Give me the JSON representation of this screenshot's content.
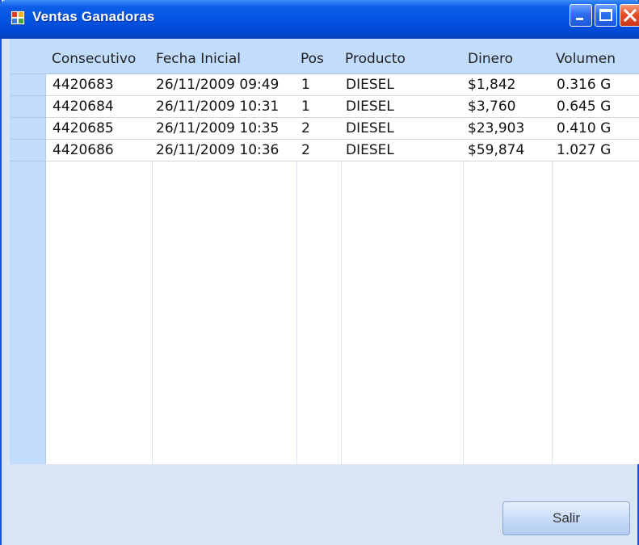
{
  "window": {
    "title": "Ventas Ganadoras",
    "icon": "app-grid-icon",
    "controls": {
      "minimize": "minimize-icon",
      "maximize": "maximize-icon",
      "close": "close-icon"
    }
  },
  "table": {
    "columns": [
      "Consecutivo",
      "Fecha Inicial",
      "Pos",
      "Producto",
      "Dinero",
      "Volumen"
    ],
    "rows": [
      [
        "4420683",
        "26/11/2009 09:49",
        "1",
        "DIESEL",
        "$1,842",
        "0.316 G"
      ],
      [
        "4420684",
        "26/11/2009 10:31",
        "1",
        "DIESEL",
        "$3,760",
        "0.645 G"
      ],
      [
        "4420685",
        "26/11/2009 10:35",
        "2",
        "DIESEL",
        "$23,903",
        "0.410 G"
      ],
      [
        "4420686",
        "26/11/2009 10:36",
        "2",
        "DIESEL",
        "$59,874",
        "1.027 G"
      ]
    ]
  },
  "footer": {
    "exit_label": "Salir"
  },
  "colors": {
    "titlebar": "#0353e1",
    "header": "#c2dcfc",
    "window_bg": "#d9e5f4"
  }
}
